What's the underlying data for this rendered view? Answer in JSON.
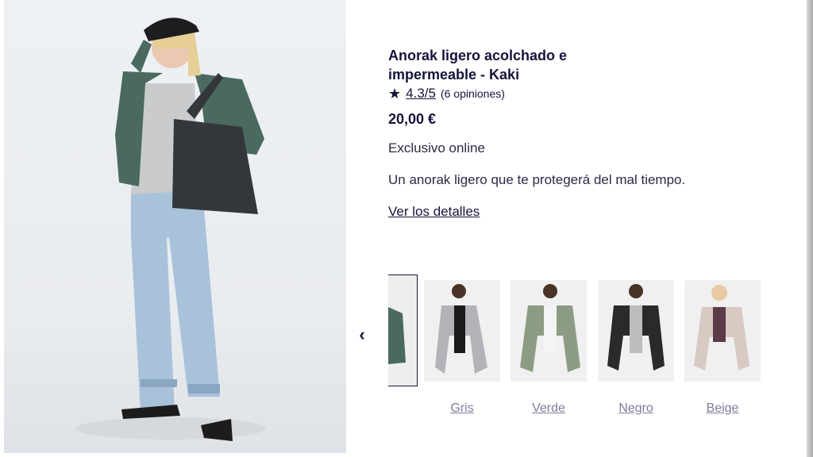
{
  "product": {
    "title_line1": "Anorak ligero acolchado e",
    "title_line2": "impermeable - Kaki",
    "rating_icon": "star-icon",
    "rating_score": "4.3/5",
    "rating_count": "(6 opiniones)",
    "price": "20,00 €",
    "exclusive": "Exclusivo online",
    "description": "Un anorak ligero que te protegerá del mal tiempo.",
    "details_link": "Ver los detalles"
  },
  "colors": {
    "prev_icon": "chevron-left-icon",
    "options": [
      {
        "label": "Gris",
        "jacket": "#b2b3b8"
      },
      {
        "label": "Verde",
        "jacket": "#8c9c84"
      },
      {
        "label": "Negro",
        "jacket": "#2a2a2a"
      },
      {
        "label": "Beige",
        "jacket": "#d8c9c2"
      }
    ],
    "current_jacket": "#4a6a60"
  }
}
